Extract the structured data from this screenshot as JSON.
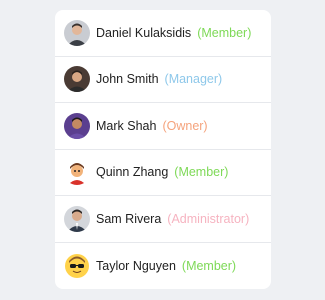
{
  "members": [
    {
      "name": "Daniel Kulaksidis",
      "role": "(Member)",
      "role_color": "#7ed957",
      "avatar": "person-avatar-icon"
    },
    {
      "name": "John Smith",
      "role": "(Manager)",
      "role_color": "#8ec8ea",
      "avatar": "person-avatar-icon"
    },
    {
      "name": "Mark Shah",
      "role": "(Owner)",
      "role_color": "#f5a37c",
      "avatar": "person-avatar-icon"
    },
    {
      "name": "Quinn Zhang",
      "role": "(Member)",
      "role_color": "#7ed957",
      "avatar": "cartoon-avatar-icon"
    },
    {
      "name": "Sam Rivera",
      "role": "(Administrator)",
      "role_color": "#f6b3c0",
      "avatar": "person-avatar-icon"
    },
    {
      "name": "Taylor Nguyen",
      "role": "(Member)",
      "role_color": "#7ed957",
      "avatar": "emoji-sunglasses-avatar-icon"
    }
  ]
}
